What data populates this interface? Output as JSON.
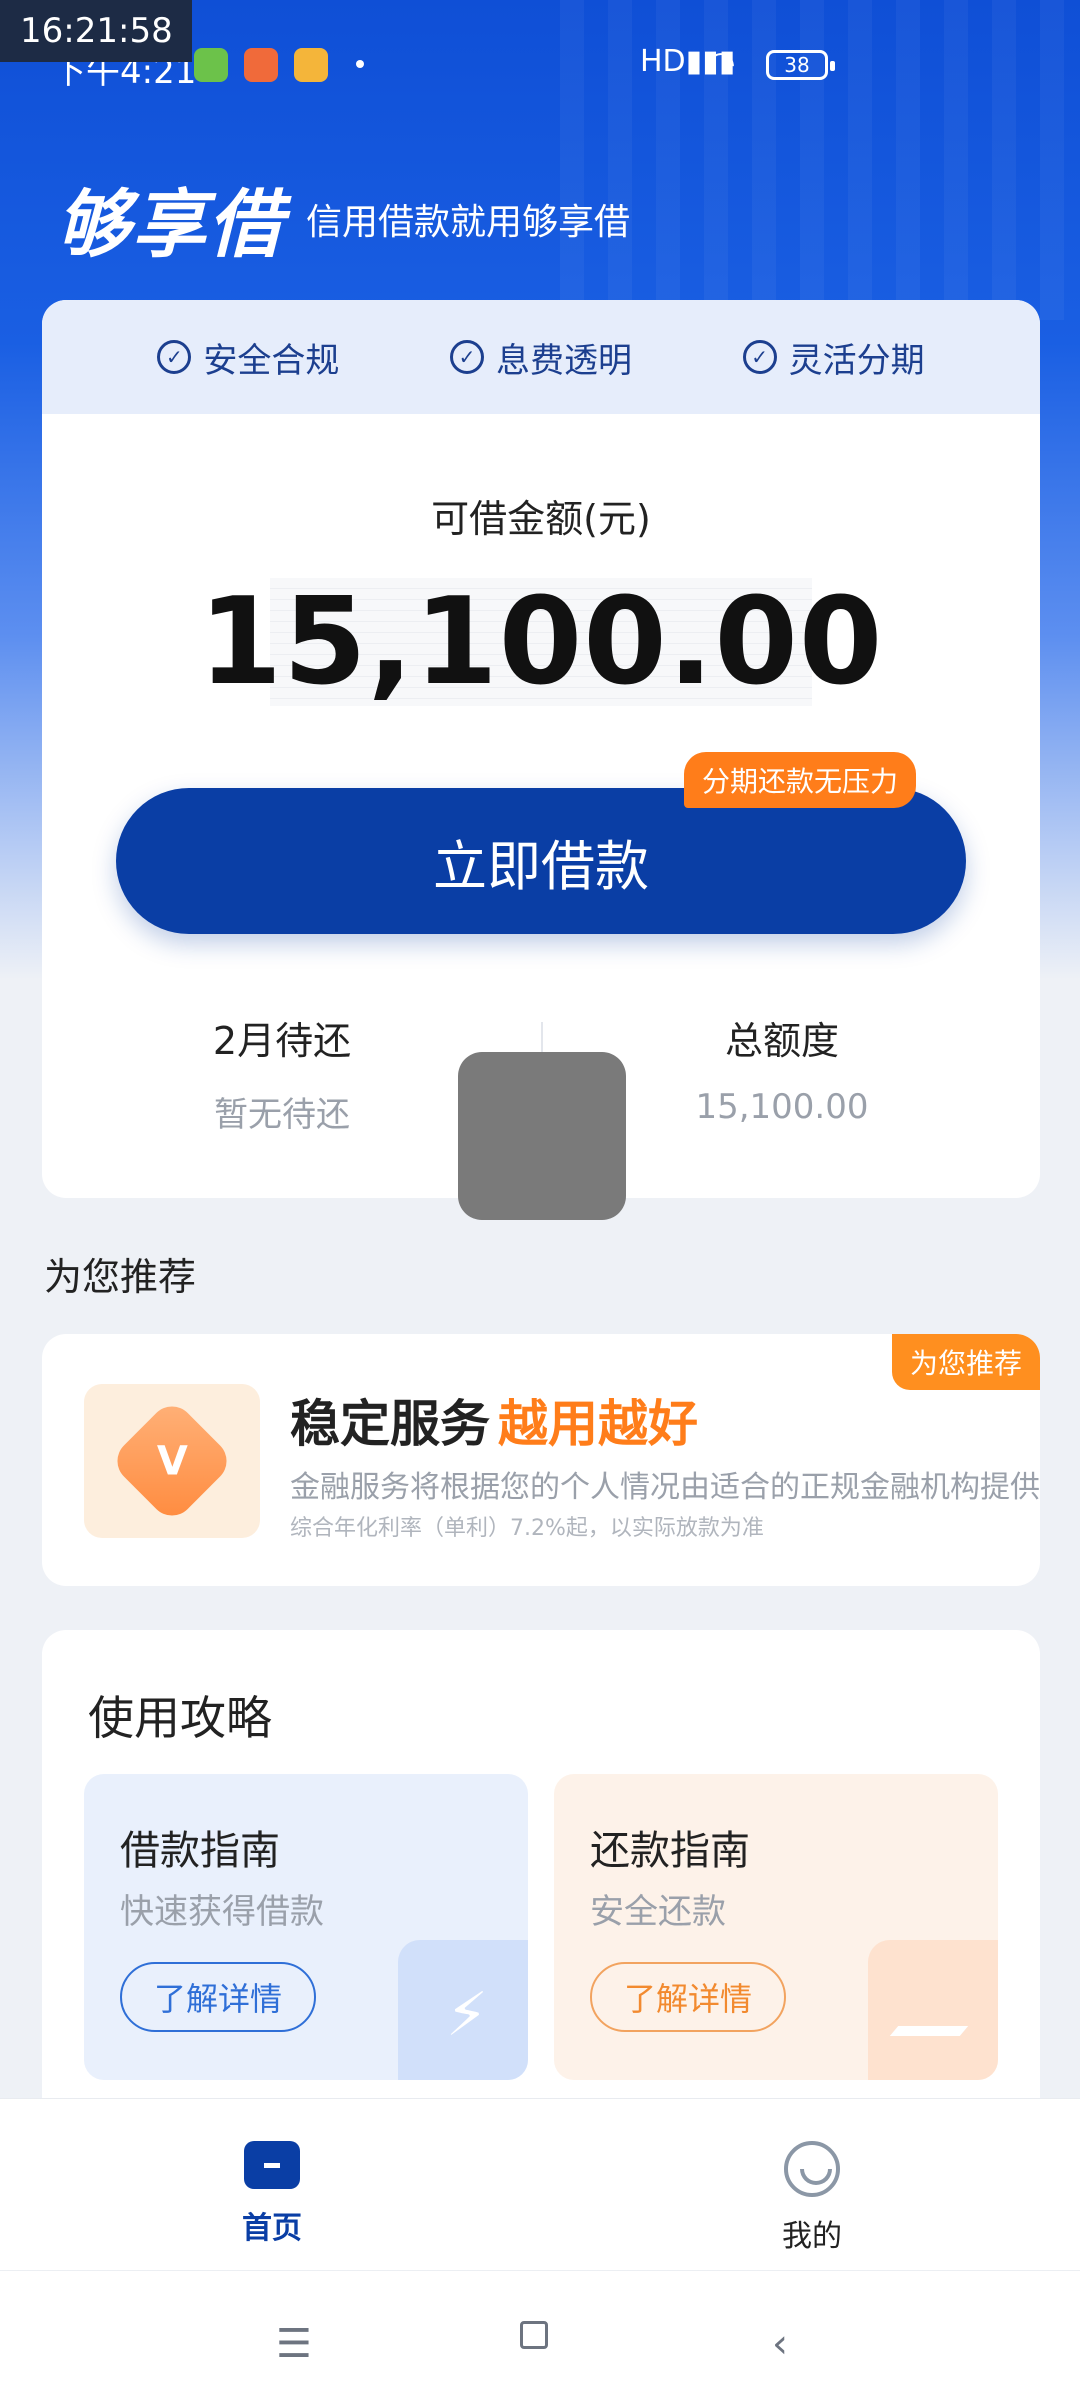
{
  "status_bar": {
    "time_overlay": "16:21:58",
    "clock": "下午4:21",
    "battery": "38",
    "signal_label": "HD"
  },
  "header": {
    "brand": "够享借",
    "slogan": "信用借款就用够享借"
  },
  "features": [
    {
      "label": "安全合规"
    },
    {
      "label": "息费透明"
    },
    {
      "label": "灵活分期"
    }
  ],
  "loan": {
    "label": "可借金额(元)",
    "amount": "15,100.00",
    "cta": "立即借款",
    "cta_tag": "分期还款无压力"
  },
  "stats": {
    "due_title": "2月待还",
    "due_value": "暂无待还",
    "total_title": "总额度",
    "total_value": "15,100.00"
  },
  "recommend": {
    "section_title": "为您推荐",
    "tag": "为您推荐",
    "title": "稳定服务",
    "title_highlight": "越用越好",
    "desc": "金融服务将根据您的个人情况由适合的正规金融机构提供",
    "note": "综合年化利率（单利）7.2%起，以实际放款为准"
  },
  "guide": {
    "title": "使用攻略",
    "items": [
      {
        "name": "借款指南",
        "desc": "快速获得借款",
        "button": "了解详情"
      },
      {
        "name": "还款指南",
        "desc": "安全还款",
        "button": "了解详情"
      }
    ]
  },
  "bottom_nav": [
    {
      "label": "首页"
    },
    {
      "label": "我的"
    }
  ],
  "colors": {
    "brand_blue": "#0a3ea5",
    "accent_orange": "#ff7d1a"
  },
  "icons": [
    "check-circle-icon",
    "home-icon",
    "profile-icon",
    "bolt-icon",
    "menu-icon",
    "square-icon",
    "back-icon"
  ]
}
